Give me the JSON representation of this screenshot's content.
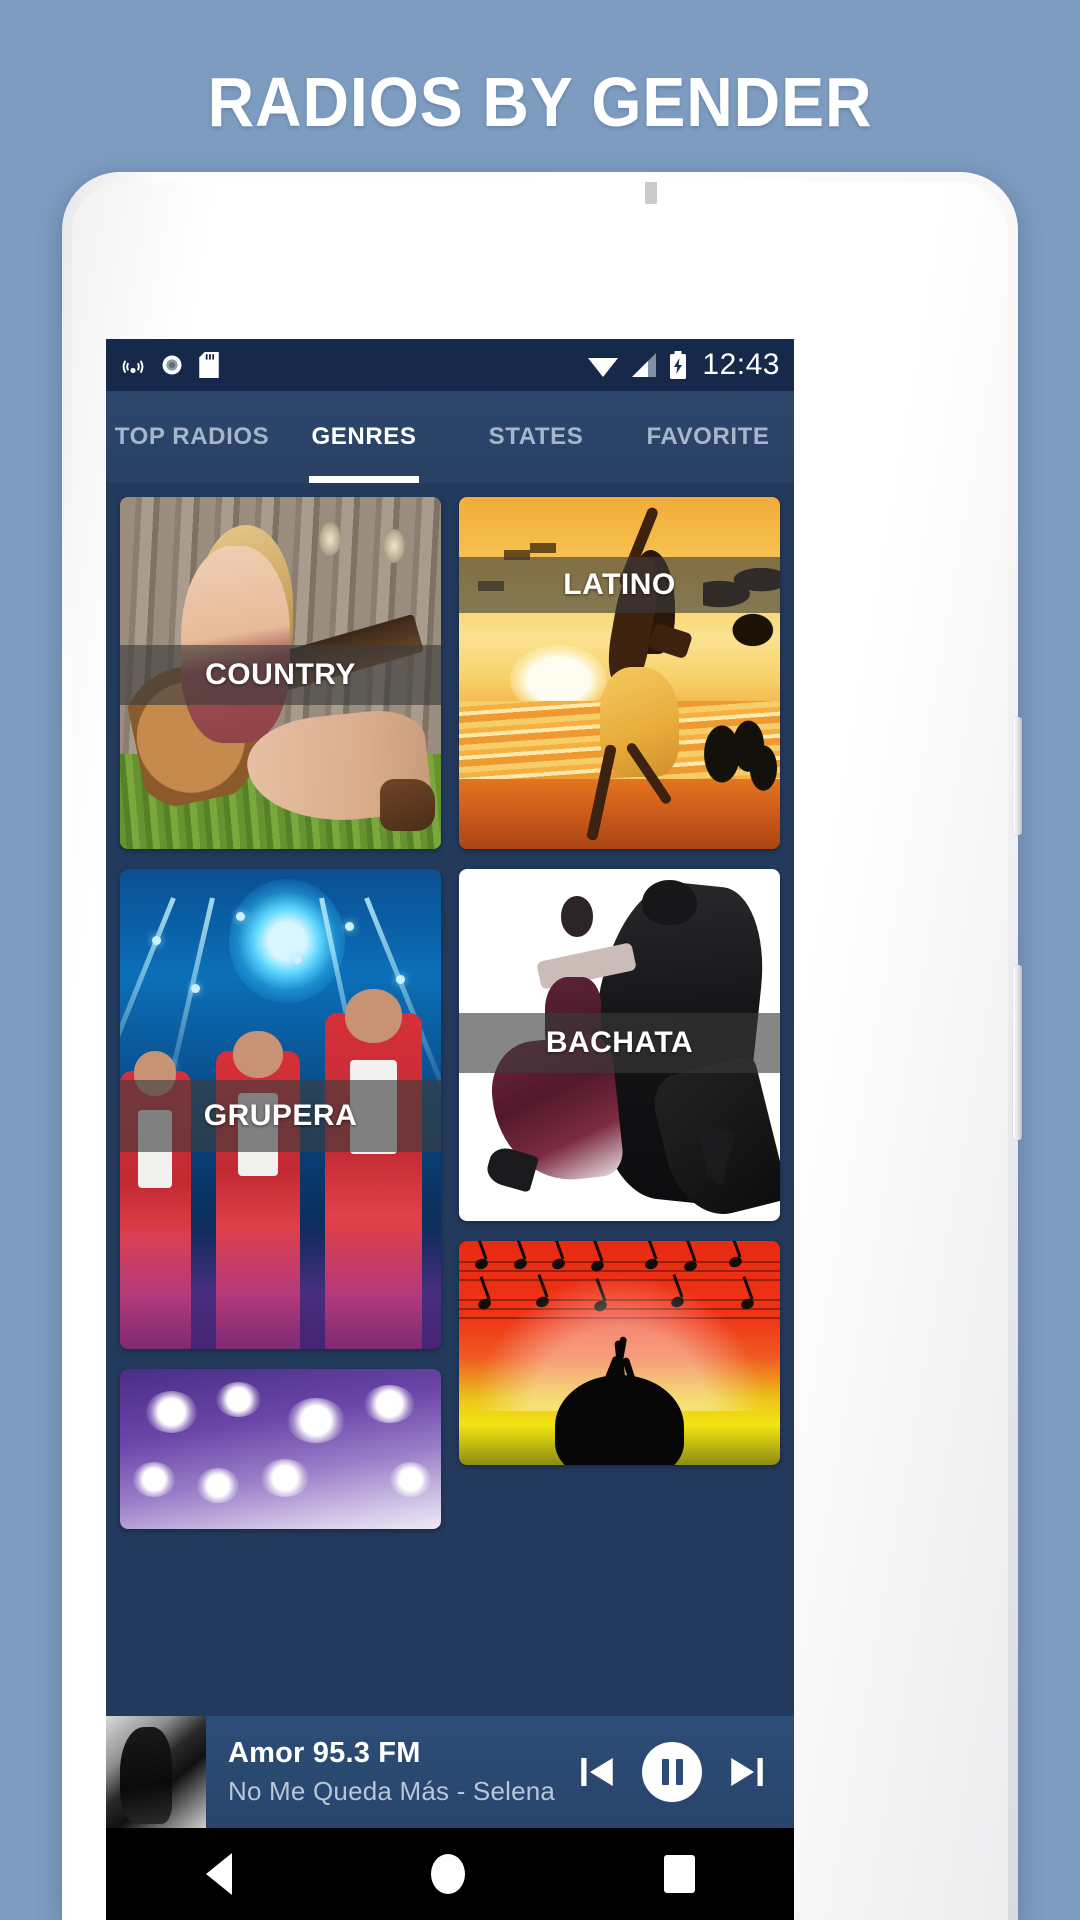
{
  "promo": {
    "title": "RADIOS BY GENDER",
    "background_color": "#7d9cc0"
  },
  "statusbar": {
    "time": "12:43",
    "left_icons": [
      "cast-icon",
      "record-circle-icon",
      "sd-card-icon"
    ],
    "right_icons": [
      "wifi-icon",
      "cellular-signal-icon",
      "battery-charging-icon"
    ],
    "background_color": "#16294a"
  },
  "tabs": [
    {
      "label": "TOP RADIOS",
      "active": false
    },
    {
      "label": "GENRES",
      "active": true
    },
    {
      "label": "STATES",
      "active": false
    },
    {
      "label": "FAVORITE",
      "active": false
    }
  ],
  "genres": [
    {
      "label": "COUNTRY",
      "art": "woman-with-acoustic-guitar-by-wooden-fence"
    },
    {
      "label": "LATINO",
      "art": "sunset-beach-dancer-silhouette"
    },
    {
      "label": "GRUPERA",
      "art": "band-in-red-suits-on-blue-lit-stage"
    },
    {
      "label": "BACHATA",
      "art": "black-and-white-dancing-couple"
    },
    {
      "label": "",
      "art": "red-yellow-music-sheet-dreadlocks-silhouette"
    },
    {
      "label": "",
      "art": "purple-stage-lights"
    }
  ],
  "player": {
    "station": "Amor 95.3 FM",
    "now_playing": "No Me Queda Más - Selena",
    "previous_label": "previous-track",
    "play_state_label": "pause",
    "next_label": "next-track",
    "background_color": "#2c4d77"
  },
  "navbar": {
    "back": "back",
    "home": "home",
    "recents": "recents"
  }
}
